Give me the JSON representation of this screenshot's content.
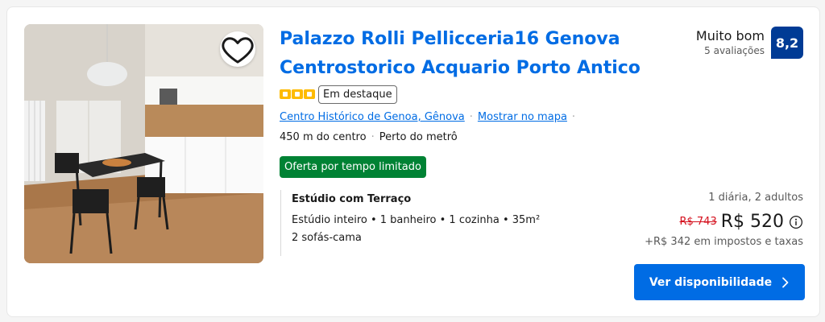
{
  "hotel": {
    "title": "Palazzo Rolli Pellicceria16 Genova Centrostorico Acquario Porto Antico",
    "stars": 3,
    "featured_badge": "Em destaque",
    "location_link": "Centro Histórico de Genoa, Gênova",
    "map_link": "Mostrar no mapa",
    "distance": "450 m do centro",
    "metro": "Perto do metrô",
    "deal_badge": "Oferta por tempo limitado"
  },
  "review": {
    "word": "Muito bom",
    "count": "5 avaliações",
    "score": "8,2"
  },
  "room": {
    "name": "Estúdio com Terraço",
    "details": "Estúdio inteiro • 1 banheiro • 1 cozinha • 35m²",
    "beds": "2 sofás-cama"
  },
  "price": {
    "stay_info": "1 diária, 2 adultos",
    "old_price": "R$ 743",
    "new_price": "R$ 520",
    "taxes": "+R$ 342 em impostos e taxas"
  },
  "cta": {
    "label": "Ver disponibilidade"
  },
  "colors": {
    "brand_blue": "#006ce4",
    "score_blue": "#003b95",
    "deal_green": "#008234",
    "star_yellow": "#febb02",
    "strike_red": "#d4111e"
  },
  "icons": {
    "favorite": "heart-icon",
    "info": "info-icon",
    "cta_arrow": "chevron-right-icon"
  }
}
